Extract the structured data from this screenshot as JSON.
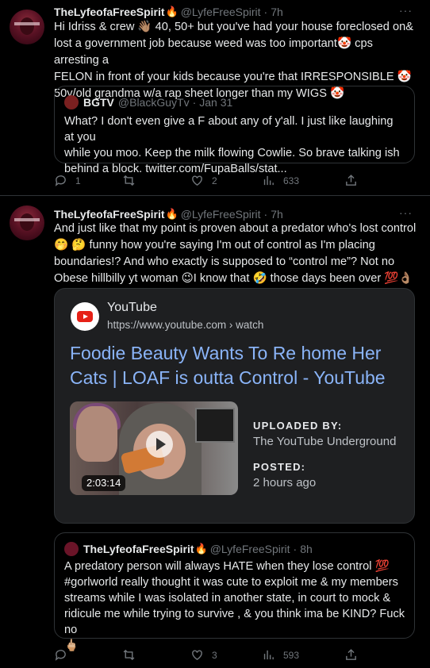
{
  "tweet1": {
    "name": "TheLyfeofaFreeSpirit",
    "handle": "@LyfeFreeSpirit",
    "time": "7h",
    "more": "···",
    "lines": [
      "Hi Idriss & crew 👋🏽 40, 50+ but you've had your house foreclosed on&",
      "lost a government job because weed was too important🤡 cps arresting a",
      "FELON in front of your kids because you're that IRRESPONSIBLE 🤡",
      "50y/old grandma w/a rap sheet longer than my WIGS 🤡"
    ],
    "quote": {
      "name": "BGTV",
      "handle": "@BlackGuyTv",
      "time": "Jan 31",
      "lines": [
        "What? I don't even give a F about any of y'all. I just like laughing at you",
        "while you moo. Keep the milk flowing Cowlie. So brave talking ish",
        "behind a block. twitter.com/FupaBalls/stat..."
      ]
    },
    "actions": {
      "replies": "1",
      "retweets": "",
      "likes": "2",
      "views": "633"
    }
  },
  "tweet2": {
    "name": "TheLyfeofaFreeSpirit",
    "handle": "@LyfeFreeSpirit",
    "time": "7h",
    "more": "···",
    "lines": [
      "And just like that my point is proven about a predator who's lost control",
      "🤭 🤔 funny how you're saying I'm out of control as I'm placing",
      "boundaries!? And who exactly is supposed to “control me”?  Not no",
      "Obese hillbilly yt woman 😉I know that 🤣 those days been over 💯👌🏽"
    ],
    "card": {
      "site": "YouTube",
      "url": "https://www.youtube.com › watch",
      "title": "Foodie Beauty Wants To Re home Her Cats | LOAF is outta Control - YouTube",
      "duration": "2:03:14",
      "uploaded_label": "UPLOADED BY:",
      "uploaded_value": "The YouTube Underground",
      "posted_label": "POSTED:",
      "posted_value": "2 hours ago"
    },
    "quote": {
      "name": "TheLyfeofaFreeSpirit",
      "handle": "@LyfeFreeSpirit",
      "time": "8h",
      "lines": [
        "A predatory person will always HATE when they lose control 💯",
        "#gorlworld really thought it was cute to exploit me & my members",
        "streams while I was isolated in another state, in court  to mock &",
        "ridicule me while trying to survive , & you think ima be KIND? Fuck no",
        "🖕🏼"
      ]
    },
    "actions": {
      "replies": "",
      "retweets": "",
      "likes": "3",
      "views": "593"
    }
  },
  "colors": {
    "background": "#000000",
    "text": "#e7e9ea",
    "muted": "#71767b",
    "border": "#2f3336",
    "link": "#8ab4f8"
  },
  "icons": [
    "reply-icon",
    "retweet-icon",
    "like-icon",
    "views-icon",
    "share-icon",
    "youtube-logo-icon",
    "play-icon",
    "fire-emoji-icon"
  ]
}
